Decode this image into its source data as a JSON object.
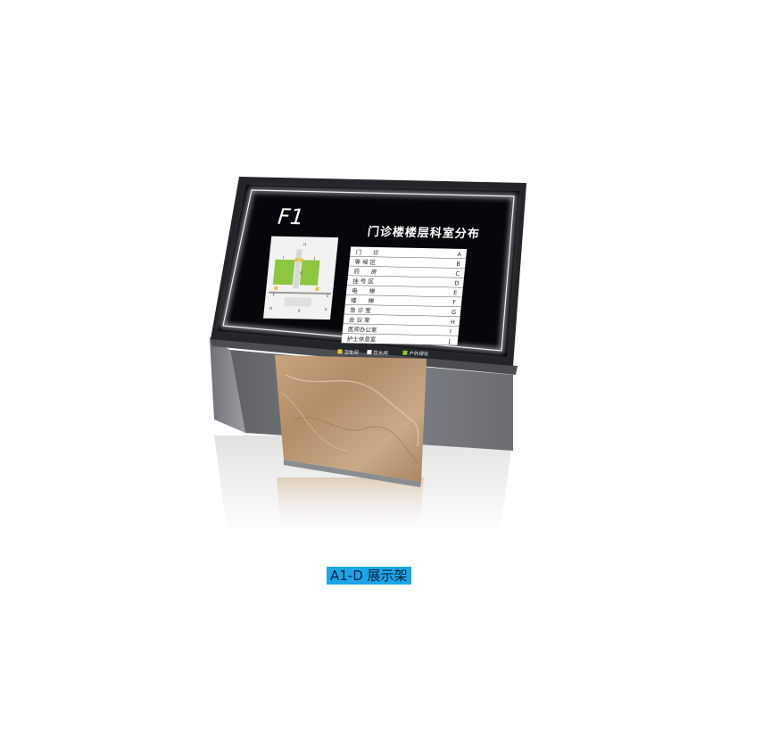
{
  "sign": {
    "floor": "F1",
    "title": "门诊楼楼层科室分布",
    "directory": [
      {
        "name": "门　　诊",
        "code": "A"
      },
      {
        "name": "等 候 区",
        "code": "B"
      },
      {
        "name": "药　　房",
        "code": "C"
      },
      {
        "name": "挂 号 区",
        "code": "D"
      },
      {
        "name": "电　　梯",
        "code": "E"
      },
      {
        "name": "楼　　梯",
        "code": "F"
      },
      {
        "name": "急 诊 室",
        "code": "G"
      },
      {
        "name": "会 议 室",
        "code": "H"
      },
      {
        "name": "医师办公室",
        "code": "I"
      },
      {
        "name": "护士休息室",
        "code": "J"
      }
    ],
    "legend": [
      {
        "label": "卫生间",
        "color": "#e8c23a"
      },
      {
        "label": "饮水间",
        "color": "#ffffff"
      },
      {
        "label": "户外绿化",
        "color": "#8cc63f"
      }
    ],
    "map_labels": [
      "H",
      "I",
      "J",
      "G",
      "F",
      "C",
      "A",
      "D",
      "E"
    ]
  },
  "caption": "A1-D 展示架"
}
